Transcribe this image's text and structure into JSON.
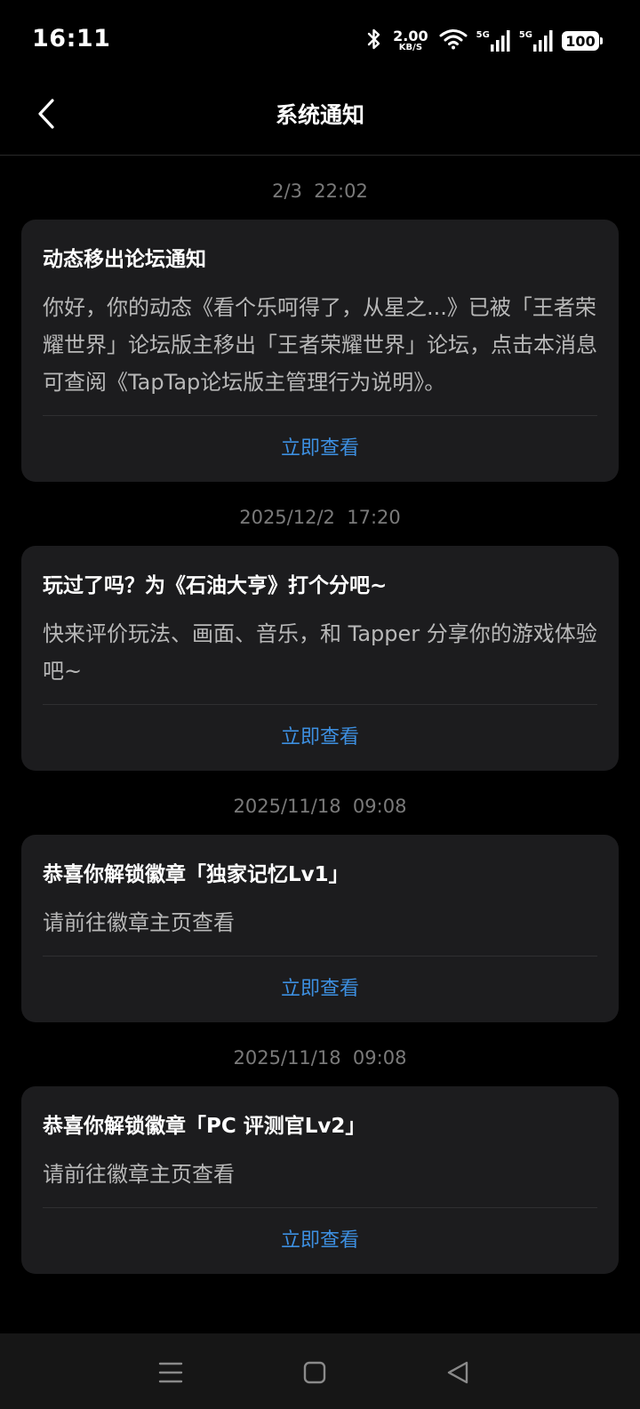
{
  "status_bar": {
    "time": "16:11",
    "net_speed_value": "2.00",
    "net_speed_unit": "KB/S",
    "signal_1_label": "5G",
    "signal_2_label": "5G",
    "battery": "100",
    "icons": [
      "bluetooth-icon",
      "wifi-icon",
      "signal-icon",
      "signal-icon"
    ]
  },
  "header": {
    "title": "系统通知",
    "back_icon": "chevron-left-icon"
  },
  "notifications": [
    {
      "time": "2/3  22:02",
      "title": "动态移出论坛通知",
      "body": "你好，你的动态《看个乐呵得了，从星之...》已被「王者荣耀世界」论坛版主移出「王者荣耀世界」论坛，点击本消息可查阅《TapTap论坛版主管理行为说明》。",
      "action": "立即查看"
    },
    {
      "time": "2025/12/2  17:20",
      "title": "玩过了吗？为《石油大亨》打个分吧~",
      "body": "快来评价玩法、画面、音乐，和 Tapper 分享你的游戏体验吧~",
      "action": "立即查看"
    },
    {
      "time": "2025/11/18  09:08",
      "title": "恭喜你解锁徽章「独家记忆Lv1」",
      "body": "请前往徽章主页查看",
      "action": "立即查看"
    },
    {
      "time": "2025/11/18  09:08",
      "title": "恭喜你解锁徽章「PC 评测官Lv2」",
      "body": "请前往徽章主页查看",
      "action": "立即查看"
    }
  ],
  "system_nav": {
    "icons": [
      "menu-icon",
      "home-icon",
      "back-triangle-icon"
    ]
  },
  "colors": {
    "background": "#000000",
    "card": "#1c1c1e",
    "accent": "#3d8fe0",
    "timestamp": "#7a7a7a",
    "body_text": "#b8b8b8"
  }
}
